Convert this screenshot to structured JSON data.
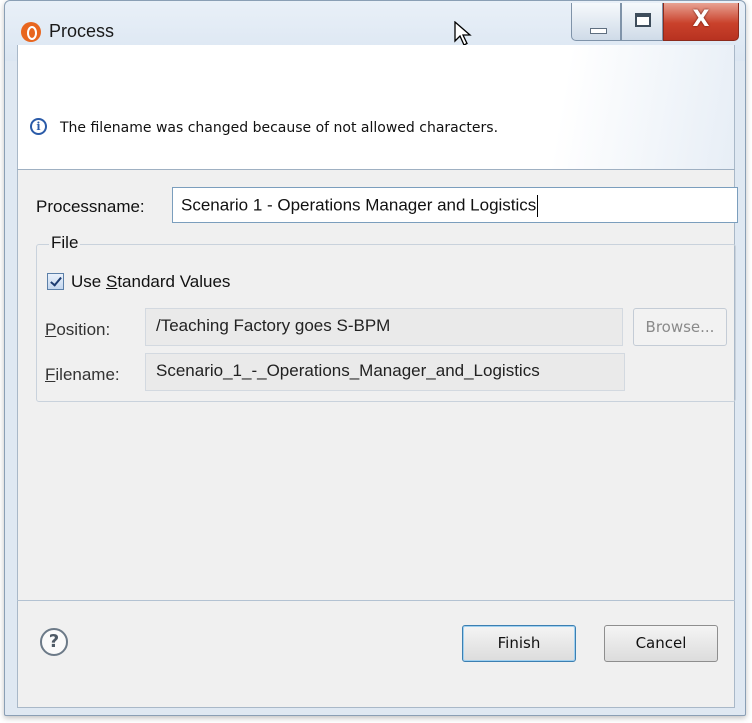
{
  "window": {
    "title": "Process",
    "title_icon": "process-app-icon",
    "controls": {
      "minimize": "minimize",
      "maximize": "maximize",
      "close": "X"
    }
  },
  "header": {
    "info_icon": "i",
    "message": "The filename was changed because of not allowed characters."
  },
  "form": {
    "processname_label": "Processname:",
    "processname_value": "Scenario 1 - Operations Manager and Logistics",
    "file_group": {
      "legend": "File",
      "use_standard_values": {
        "label_pre": "Use ",
        "label_mnemonic": "S",
        "label_post": "tandard Values",
        "checked": true
      },
      "position_label_mnemonic": "P",
      "position_label_rest": "osition:",
      "position_value": "/Teaching Factory goes S-BPM",
      "browse_label": "Browse...",
      "filename_label_mnemonic": "F",
      "filename_label_rest": "ilename:",
      "filename_value": "Scenario_1_-_Operations_Manager_and_Logistics"
    }
  },
  "footer": {
    "help_icon": "?",
    "finish_label": "Finish",
    "cancel_label": "Cancel"
  },
  "colors": {
    "titlebar": "#dbe6f2",
    "close_button": "#c9412b",
    "info_icon": "#2b5ba8",
    "dialog_bg": "#f0f0f0"
  }
}
